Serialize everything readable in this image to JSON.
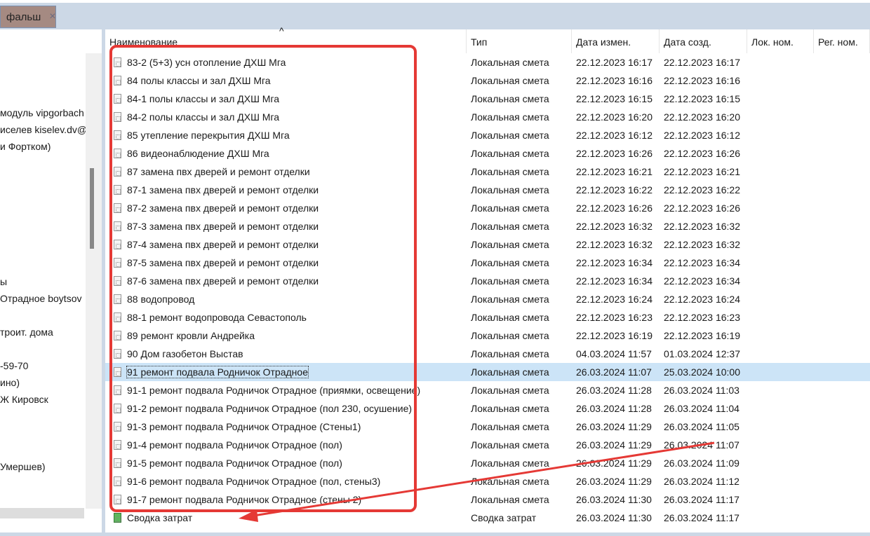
{
  "tab": {
    "label": "фальш",
    "close": "×"
  },
  "left_panel": [
    "модуль vipgorbach",
    "иселев kiselev.dv@",
    "и Фортком)",
    "ы",
    "Отрадное boytsov",
    "троит. дома",
    "-59-70",
    "ино)",
    "Ж Кировск",
    "Умершев)"
  ],
  "columns": [
    "Наименование",
    "Тип",
    "Дата измен.",
    "Дата созд.",
    "Лок. ном.",
    "Рег. ном."
  ],
  "sort_indicator": "^",
  "rows": [
    [
      "83-2 (5+3) усн отопление ДХШ Мга",
      "Локальная смета",
      "22.12.2023 16:17",
      "22.12.2023 16:17"
    ],
    [
      "84 полы классы и зал ДХШ Мга",
      "Локальная смета",
      "22.12.2023 16:16",
      "22.12.2023 16:16"
    ],
    [
      "84-1 полы классы и зал ДХШ Мга",
      "Локальная смета",
      "22.12.2023 16:15",
      "22.12.2023 16:15"
    ],
    [
      "84-2 полы классы и зал ДХШ Мга",
      "Локальная смета",
      "22.12.2023 16:20",
      "22.12.2023 16:20"
    ],
    [
      "85 утепление перекрытия ДХШ Мга",
      "Локальная смета",
      "22.12.2023 16:12",
      "22.12.2023 16:12"
    ],
    [
      "86 видеонаблюдение ДХШ Мга",
      "Локальная смета",
      "22.12.2023 16:26",
      "22.12.2023 16:26"
    ],
    [
      "87 замена пвх дверей и ремонт отделки",
      "Локальная смета",
      "22.12.2023 16:21",
      "22.12.2023 16:21"
    ],
    [
      "87-1 замена пвх дверей и ремонт отделки",
      "Локальная смета",
      "22.12.2023 16:22",
      "22.12.2023 16:22"
    ],
    [
      "87-2 замена пвх дверей и ремонт отделки",
      "Локальная смета",
      "22.12.2023 16:26",
      "22.12.2023 16:26"
    ],
    [
      "87-3 замена пвх дверей и ремонт отделки",
      "Локальная смета",
      "22.12.2023 16:32",
      "22.12.2023 16:32"
    ],
    [
      "87-4 замена пвх дверей и ремонт отделки",
      "Локальная смета",
      "22.12.2023 16:32",
      "22.12.2023 16:32"
    ],
    [
      "87-5 замена пвх дверей и ремонт отделки",
      "Локальная смета",
      "22.12.2023 16:34",
      "22.12.2023 16:34"
    ],
    [
      "87-6 замена пвх дверей и ремонт отделки",
      "Локальная смета",
      "22.12.2023 16:34",
      "22.12.2023 16:34"
    ],
    [
      "88 водопровод",
      "Локальная смета",
      "22.12.2023 16:24",
      "22.12.2023 16:24"
    ],
    [
      "88-1 ремонт водопровода Севастополь",
      "Локальная смета",
      "22.12.2023 16:23",
      "22.12.2023 16:23"
    ],
    [
      "89 ремонт кровли Андрейка",
      "Локальная смета",
      "22.12.2023 16:19",
      "22.12.2023 16:19"
    ],
    [
      "90 Дом газобетон Выстав",
      "Локальная смета",
      "04.03.2024 11:57",
      "01.03.2024 12:37"
    ],
    [
      "91 ремонт подвала Родничок Отрадное",
      "Локальная смета",
      "26.03.2024 11:07",
      "25.03.2024 10:00"
    ],
    [
      "91-1 ремонт подвала Родничок Отрадное (приямки, освещение)",
      "Локальная смета",
      "26.03.2024 11:28",
      "26.03.2024 11:03"
    ],
    [
      "91-2 ремонт подвала Родничок Отрадное (пол 230, осушение)",
      "Локальная смета",
      "26.03.2024 11:28",
      "26.03.2024 11:04"
    ],
    [
      "91-3 ремонт подвала Родничок Отрадное (Стены1)",
      "Локальная смета",
      "26.03.2024 11:29",
      "26.03.2024 11:05"
    ],
    [
      "91-4 ремонт подвала Родничок Отрадное (пол)",
      "Локальная смета",
      "26.03.2024 11:29",
      "26.03.2024 11:07"
    ],
    [
      "91-5 ремонт подвала Родничок Отрадное (пол)",
      "Локальная смета",
      "26.03.2024 11:29",
      "26.03.2024 11:09"
    ],
    [
      "91-6 ремонт подвала Родничок Отрадное (пол, стены3)",
      "Локальная смета",
      "26.03.2024 11:29",
      "26.03.2024 11:12"
    ],
    [
      "91-7 ремонт подвала Родничок Отрадное (стены 2)",
      "Локальная смета",
      "26.03.2024 11:30",
      "26.03.2024 11:17"
    ],
    [
      "Сводка затрат",
      "Сводка затрат",
      "26.03.2024 11:30",
      "26.03.2024 11:17"
    ]
  ],
  "selected_index": 17,
  "annotation_color": "#e53935"
}
